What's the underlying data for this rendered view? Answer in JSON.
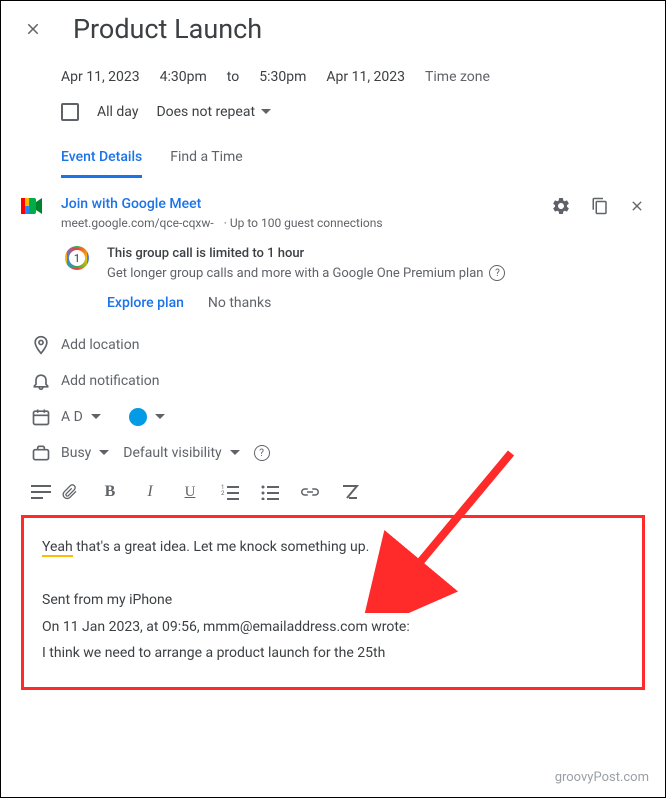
{
  "header": {
    "title": "Product Launch"
  },
  "datetime": {
    "date1": "Apr 11, 2023",
    "time1": "4:30pm",
    "to": "to",
    "time2": "5:30pm",
    "date2": "Apr 11, 2023",
    "timezone": "Time zone"
  },
  "allday": {
    "label": "All day",
    "repeat": "Does not repeat"
  },
  "tabs": {
    "details": "Event Details",
    "find": "Find a Time"
  },
  "meet": {
    "link_label": "Join with Google Meet",
    "url": "meet.google.com/qce-cqxw-",
    "guests": "Up to 100 guest connections"
  },
  "promo": {
    "title": "This group call is limited to 1 hour",
    "sub": "Get longer group calls and more with a Google One Premium plan",
    "explore": "Explore plan",
    "no": "No thanks"
  },
  "location": {
    "placeholder": "Add location"
  },
  "notification": {
    "placeholder": "Add notification"
  },
  "calendar": {
    "owner": "A D"
  },
  "availability": {
    "busy": "Busy",
    "visibility": "Default visibility"
  },
  "description": {
    "line1_a": "Yeah",
    "line1_b": " that's a great idea. Let me knock something up.",
    "line2": "Sent from my iPhone",
    "line3": "On 11 Jan 2023, at 09:56, mmm@emailaddress.com wrote:",
    "line4": "I think we need to arrange a product launch for the 25th"
  },
  "watermark": "groovyPost.com"
}
